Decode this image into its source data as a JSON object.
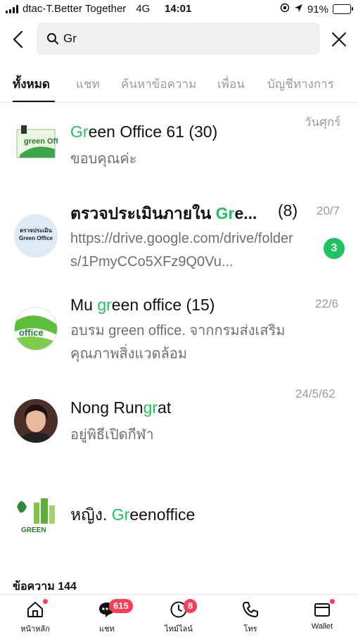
{
  "status_bar": {
    "carrier": "dtac-T.Better Together",
    "network": "4G",
    "time": "14:01",
    "battery": "91%",
    "battery_level": 0.91
  },
  "search": {
    "query": "Gr"
  },
  "tabs": [
    {
      "label": "ทั้งหมด",
      "active": true
    },
    {
      "label": "แชท"
    },
    {
      "label": "ค้นหาข้อความ"
    },
    {
      "label": "เพื่อน"
    },
    {
      "label": "บัญชีทางการ"
    }
  ],
  "results": [
    {
      "title_pre": "",
      "title_match": "Gr",
      "title_post": "een Office 61 (30)",
      "preview": "ขอบคุณค่ะ",
      "date": "วันศุกร์",
      "avatar_text": "green Office"
    },
    {
      "title_pre": "ตรวจประเมินภายใน ",
      "title_match": "Gr",
      "title_post": "e...",
      "title_count": "(8)",
      "preview": "https://drive.google.com/drive/folders/1PmyCCo5XFz9Q0Vu...",
      "date": "20/7",
      "unread": "3",
      "avatar_text_1": "ตรวจประเมิน",
      "avatar_text_2": "Green Office"
    },
    {
      "title_pre": "Mu ",
      "title_match": "gr",
      "title_post": "een office (15)",
      "preview": "อบรม green office.  จากกรมส่งเสริมคุณภาพสิ่งแวดล้อม",
      "date": "22/6",
      "avatar_text": "office"
    },
    {
      "title_pre": "Nong Run",
      "title_match": "gr",
      "title_post": "at",
      "preview": "อยู่พิธีเปิดกีฬา",
      "date": "24/5/62"
    },
    {
      "title_pre": "หญิง. ",
      "title_match": "Gr",
      "title_post": "eenoffice",
      "avatar_text": "GREEN"
    }
  ],
  "section": {
    "label": "ข้อความ 144"
  },
  "bottom_nav": [
    {
      "label": "หน้าหลัก",
      "icon": "home-icon"
    },
    {
      "label": "แชท",
      "icon": "chat-icon",
      "badge": "615"
    },
    {
      "label": "ไทม์ไลน์",
      "icon": "timeline-icon",
      "badge": "8"
    },
    {
      "label": "โทร",
      "icon": "phone-icon"
    },
    {
      "label": "Wallet",
      "icon": "wallet-icon"
    }
  ],
  "colors": {
    "accent": "#1fc35f",
    "badge": "#ff3b55"
  }
}
